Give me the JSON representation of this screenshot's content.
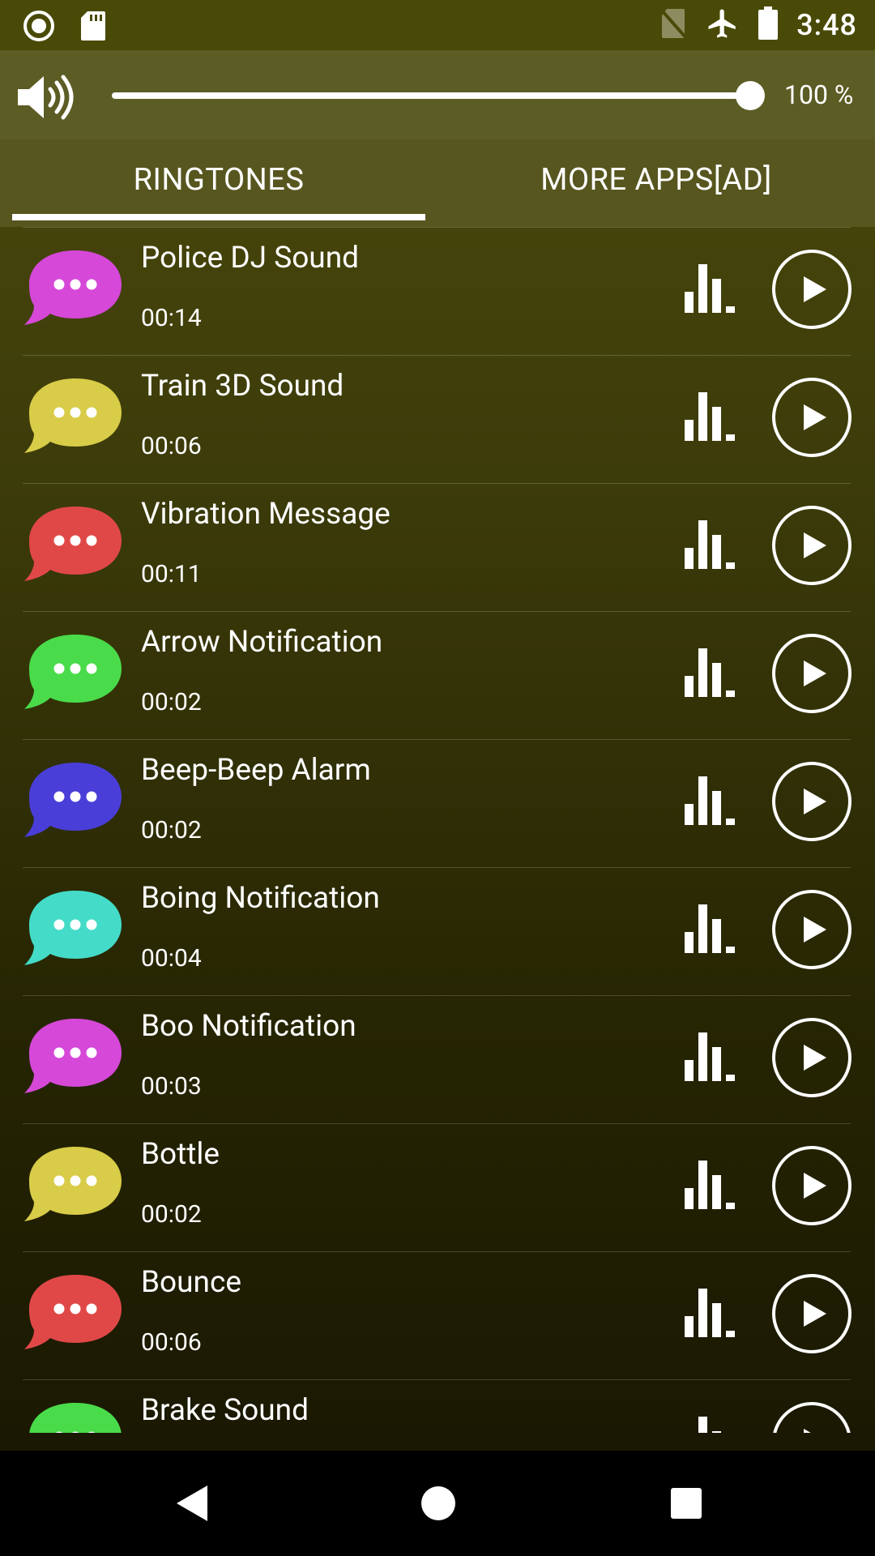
{
  "status_bar": {
    "time": "3:48",
    "left_icons": [
      "record-circle-icon",
      "sd-card-icon"
    ],
    "right_icons": [
      "no-sim-icon",
      "airplane-icon",
      "battery-icon"
    ]
  },
  "volume": {
    "percent_label": "100 %",
    "level": 1.0
  },
  "tabs": [
    {
      "label": "RINGTONES",
      "active": true
    },
    {
      "label": "MORE APPS[AD]",
      "active": false
    }
  ],
  "colors": {
    "magenta": "#d548d8",
    "yellow": "#d8cc48",
    "red": "#e04848",
    "green": "#4adb4a",
    "blue": "#4a3ed8",
    "cyan": "#44dcc8"
  },
  "ringtones": [
    {
      "title": "Police DJ Sound",
      "duration": "00:14",
      "color": "#d548d8"
    },
    {
      "title": "Train 3D Sound",
      "duration": "00:06",
      "color": "#d8cc48"
    },
    {
      "title": "Vibration Message",
      "duration": "00:11",
      "color": "#e04848"
    },
    {
      "title": "Arrow Notification",
      "duration": "00:02",
      "color": "#4adb4a"
    },
    {
      "title": "Beep-Beep Alarm",
      "duration": "00:02",
      "color": "#4a3ed8"
    },
    {
      "title": "Boing Notification",
      "duration": "00:04",
      "color": "#44dcc8"
    },
    {
      "title": "Boo Notification",
      "duration": "00:03",
      "color": "#d548d8"
    },
    {
      "title": "Bottle",
      "duration": "00:02",
      "color": "#d8cc48"
    },
    {
      "title": "Bounce",
      "duration": "00:06",
      "color": "#e04848"
    },
    {
      "title": "Brake Sound",
      "duration": "",
      "color": "#4adb4a"
    }
  ],
  "nav": [
    "back-icon",
    "home-icon",
    "recents-icon"
  ]
}
